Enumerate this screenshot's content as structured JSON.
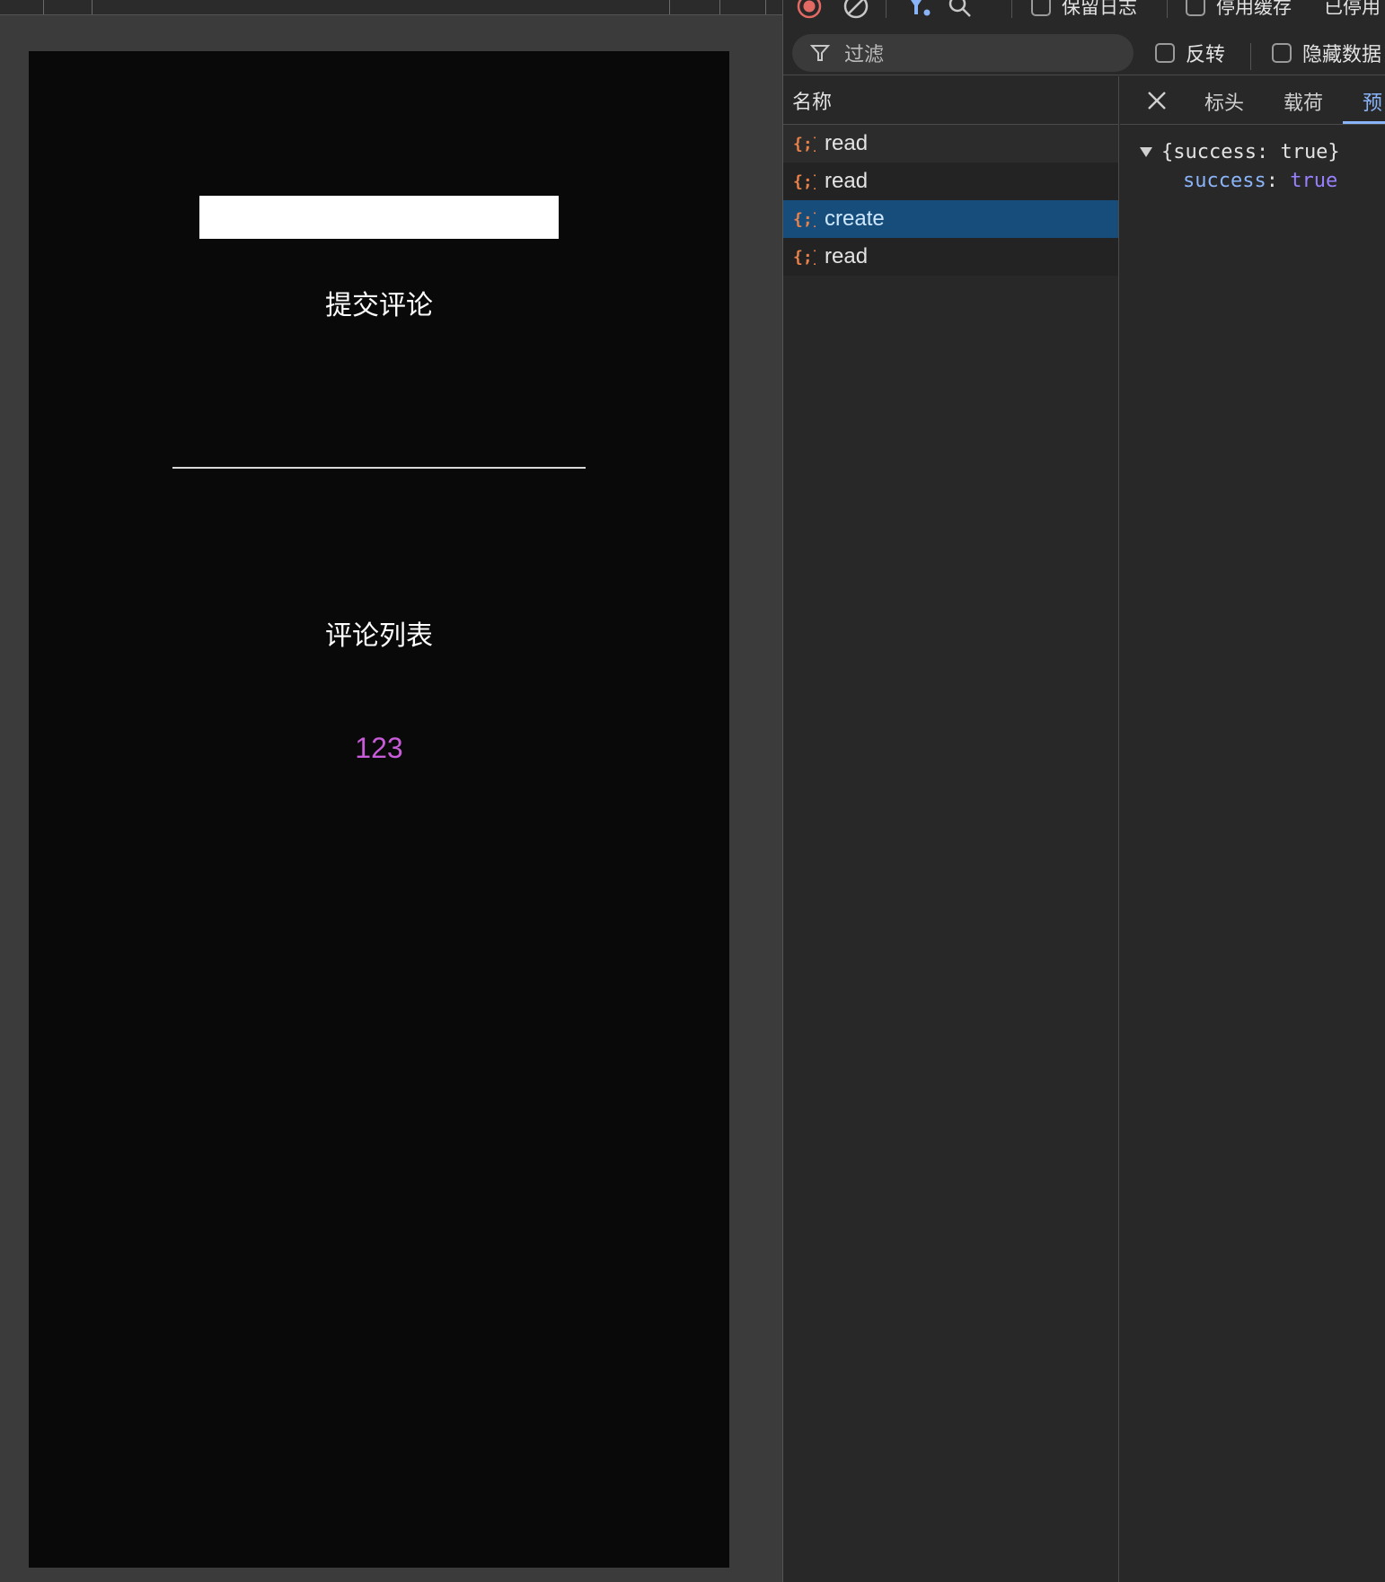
{
  "page": {
    "input": {
      "value": "",
      "placeholder": ""
    },
    "submit_label": "提交评论",
    "list_title": "评论列表",
    "comments": [
      "123"
    ]
  },
  "devtools": {
    "toolbar": {
      "preserve_log": "保留日志",
      "disable_cache": "停用缓存",
      "throttle": "已停用"
    },
    "filterbar": {
      "filter_placeholder": "过滤",
      "invert": "反转",
      "hide_data": "隐藏数据"
    },
    "requests": {
      "header": "名称",
      "rows": [
        {
          "name": "read"
        },
        {
          "name": "read"
        },
        {
          "name": "create"
        },
        {
          "name": "read"
        }
      ]
    },
    "detail": {
      "tabs": [
        "标头",
        "载荷",
        "预"
      ],
      "preview": {
        "summary": "{success: true}",
        "key": "success",
        "colon": ":",
        "value": "true"
      }
    },
    "colors": {
      "selected_row": "#174d7a",
      "accent": "#8ab4f8",
      "json_icon": "#e8824a",
      "record": "#e46962"
    }
  }
}
